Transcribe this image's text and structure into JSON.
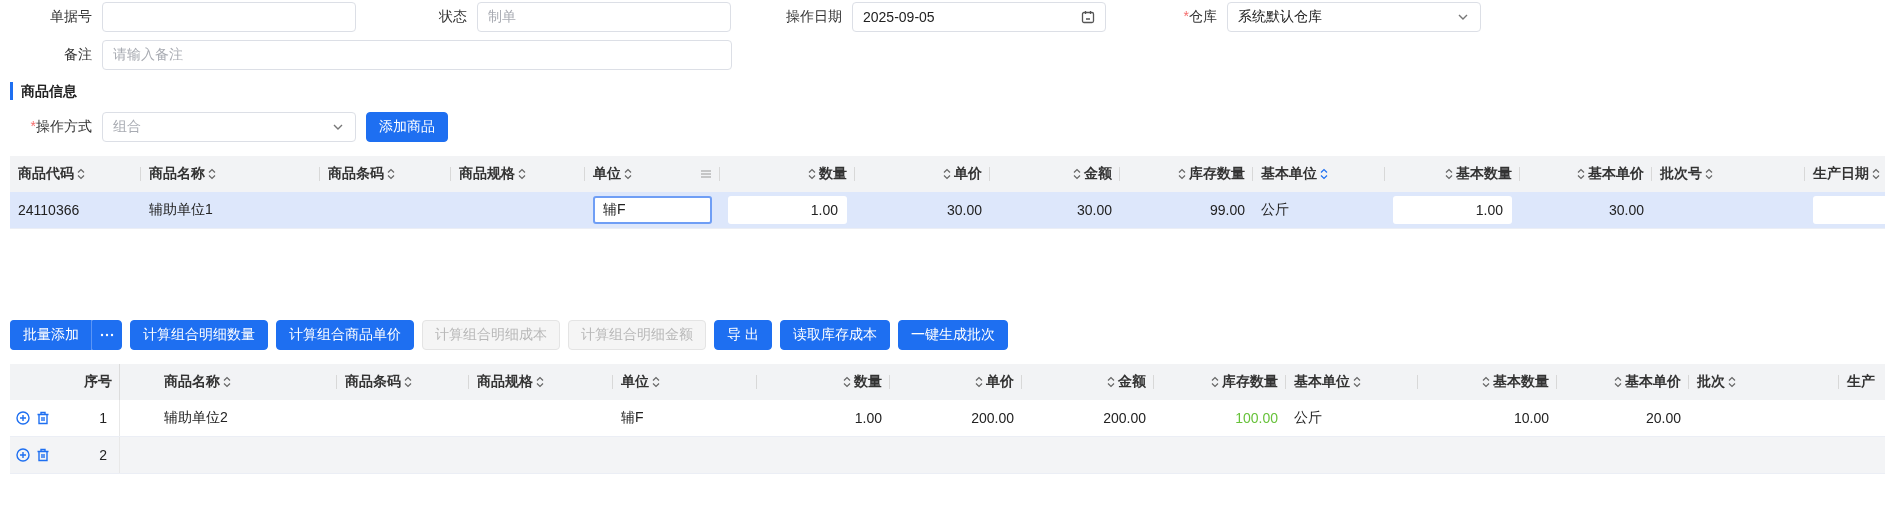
{
  "form": {
    "rows": [
      [
        {
          "label": "单据号",
          "kind": "text"
        },
        {
          "label": "状态",
          "kind": "text",
          "placeholder": "制单"
        },
        {
          "label": "操作日期",
          "kind": "date",
          "value": "2025-09-05"
        },
        {
          "label": "仓库",
          "required_mark": "*",
          "kind": "select",
          "value": "系统默认仓库"
        }
      ],
      [
        {
          "label": "备注",
          "kind": "long_text",
          "placeholder": "请输入备注"
        }
      ]
    ]
  },
  "section": {
    "title": "商品信息",
    "operation": {
      "label": "操作方式",
      "required_mark": "*",
      "kind": "select",
      "placeholder": "组合"
    },
    "add_button": "添加商品"
  },
  "main_table": {
    "columns": [
      {
        "label": "商品代码",
        "sort_active": false
      },
      {
        "label": "商品名称",
        "sort_active": false
      },
      {
        "label": "商品条码",
        "sort_active": false
      },
      {
        "label": "商品规格",
        "sort_active": false
      },
      {
        "label": "单位",
        "sort_active": false,
        "menu": true
      },
      {
        "label": "数量",
        "sort_active": false
      },
      {
        "label": "单价",
        "sort_active": false
      },
      {
        "label": "金额",
        "sort_active": false
      },
      {
        "label": "库存数量",
        "sort_active": false
      },
      {
        "label": "基本单位",
        "sort_active": true
      },
      {
        "label": "基本数量",
        "sort_active": false
      },
      {
        "label": "基本单价",
        "sort_active": false
      },
      {
        "label": "批次号",
        "sort_active": false
      },
      {
        "label": "生产日期",
        "sort_active": false
      }
    ],
    "rows": [
      {
        "selected": true,
        "cells": [
          {
            "value": "24110366"
          },
          {
            "value": "辅助单位1"
          },
          {},
          {},
          {
            "value": "辅F",
            "editable": true,
            "focused": true
          },
          {
            "value": "1.00",
            "editable": true,
            "focused": false
          },
          {
            "value": "30.00"
          },
          {
            "value": "30.00"
          },
          {
            "value": "99.00",
            "highlight": false
          },
          {
            "value": "公斤"
          },
          {
            "value": "1.00",
            "editable": true,
            "focused": false
          },
          {
            "value": "30.00"
          },
          {},
          {
            "editable": true,
            "focused": false
          }
        ]
      }
    ]
  },
  "toolbar": [
    {
      "kind": "split",
      "label": "批量添加",
      "disabled": false
    },
    {
      "kind": "button",
      "label": "计算组合明细数量",
      "disabled": false
    },
    {
      "kind": "button",
      "label": "计算组合商品单价",
      "disabled": false
    },
    {
      "kind": "button",
      "label": "计算组合明细成本",
      "disabled": true
    },
    {
      "kind": "button",
      "label": "计算组合明细金额",
      "disabled": true
    },
    {
      "kind": "button",
      "label": "导 出",
      "disabled": false
    },
    {
      "kind": "button",
      "label": "读取库存成本",
      "disabled": false
    },
    {
      "kind": "button",
      "label": "一键生成批次",
      "disabled": false
    }
  ],
  "detail_table": {
    "index_label": "序号",
    "columns": [
      {
        "label": "商品名称",
        "sort_active": false
      },
      {
        "label": "商品条码",
        "sort_active": false
      },
      {
        "label": "商品规格",
        "sort_active": false
      },
      {
        "label": "单位",
        "sort_active": false
      },
      {
        "label": "数量",
        "sort_active": false
      },
      {
        "label": "单价",
        "sort_active": false
      },
      {
        "label": "金额",
        "sort_active": false
      },
      {
        "label": "库存数量",
        "sort_active": false
      },
      {
        "label": "基本单位",
        "sort_active": false
      },
      {
        "label": "基本数量",
        "sort_active": false
      },
      {
        "label": "基本单价",
        "sort_active": false
      },
      {
        "label": "批次",
        "sort_active": false
      },
      {
        "label": "生产"
      }
    ],
    "rows": [
      {
        "index": "1",
        "hovered": false,
        "cells": [
          {
            "value": "辅助单位2"
          },
          {},
          {},
          {
            "value": "辅F"
          },
          {
            "value": "1.00"
          },
          {
            "value": "200.00"
          },
          {
            "value": "200.00"
          },
          {
            "value": "100.00",
            "highlight": true
          },
          {
            "value": "公斤"
          },
          {
            "value": "10.00"
          },
          {
            "value": "20.00"
          },
          {},
          {}
        ]
      },
      {
        "index": "2",
        "hovered": true,
        "cells": [
          {},
          {},
          {},
          {},
          {},
          {},
          {},
          {},
          {},
          {},
          {},
          {},
          {}
        ]
      }
    ]
  }
}
